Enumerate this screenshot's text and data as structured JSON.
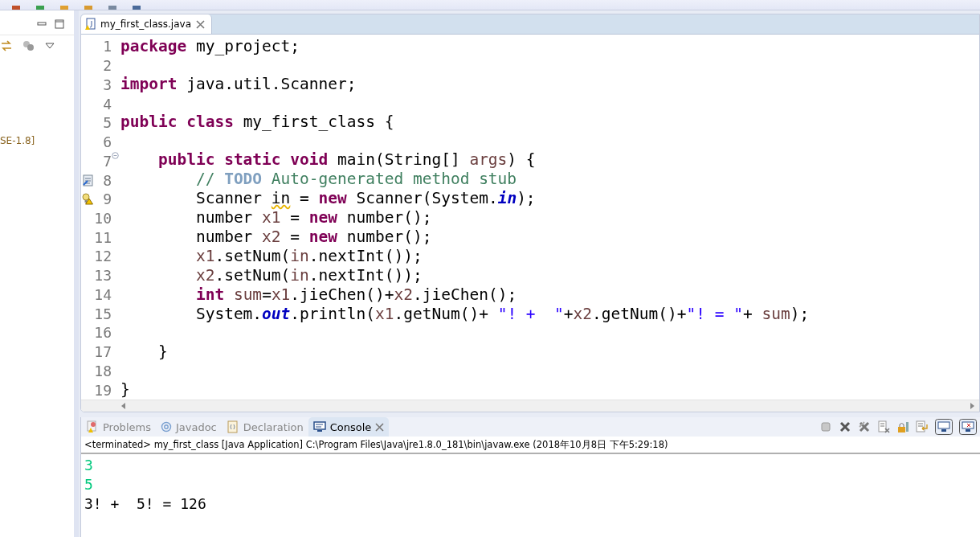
{
  "left_panel": {
    "label": "SE-1.8]"
  },
  "editor": {
    "tab": {
      "label": "my_first_class.java",
      "selected": true
    },
    "lines": [
      {
        "number": "1",
        "kind": "plain",
        "tokens": [
          {
            "kind": "kw",
            "text": "package"
          },
          {
            "kind": "plain",
            "text": " my_project;"
          }
        ]
      },
      {
        "number": "2",
        "kind": "plain"
      },
      {
        "number": "3",
        "kind": "plain",
        "tokens": [
          {
            "kind": "kw",
            "text": "import"
          },
          {
            "kind": "plain",
            "text": " java.util.Scanner;"
          }
        ]
      },
      {
        "number": "4",
        "kind": "plain"
      },
      {
        "number": "5",
        "kind": "plain",
        "tokens": [
          {
            "kind": "kw",
            "text": "public class"
          },
          {
            "kind": "plain",
            "text": " my_first_class {"
          }
        ]
      },
      {
        "number": "6",
        "kind": "plain"
      },
      {
        "number": "7",
        "kind": "fold",
        "tokens": [
          {
            "kind": "kw",
            "text": "    public static void"
          },
          {
            "kind": "plain",
            "text": " main(String[] "
          },
          {
            "kind": "var",
            "text": "args"
          },
          {
            "kind": "plain",
            "text": ") {"
          }
        ]
      },
      {
        "number": "8",
        "kind": "task",
        "tokens": [
          {
            "kind": "comment",
            "text": "        // "
          },
          {
            "kind": "todo",
            "text": "TODO"
          },
          {
            "kind": "comment",
            "text": " Auto-generated method stub"
          }
        ]
      },
      {
        "number": "9",
        "kind": "warning",
        "tokens": [
          {
            "kind": "plain",
            "text": "        Scanner "
          },
          {
            "kind": "warn",
            "text": "in"
          },
          {
            "kind": "plain",
            "text": " = "
          },
          {
            "kind": "kw",
            "text": "new"
          },
          {
            "kind": "plain",
            "text": " Scanner(System."
          },
          {
            "kind": "static",
            "text": "in"
          },
          {
            "kind": "plain",
            "text": ");"
          }
        ]
      },
      {
        "number": "10",
        "kind": "plain",
        "tokens": [
          {
            "kind": "plain",
            "text": "        number "
          },
          {
            "kind": "var",
            "text": "x1"
          },
          {
            "kind": "plain",
            "text": " = "
          },
          {
            "kind": "kw",
            "text": "new"
          },
          {
            "kind": "plain",
            "text": " number();"
          }
        ]
      },
      {
        "number": "11",
        "kind": "plain",
        "tokens": [
          {
            "kind": "plain",
            "text": "        number "
          },
          {
            "kind": "var",
            "text": "x2"
          },
          {
            "kind": "plain",
            "text": " = "
          },
          {
            "kind": "kw",
            "text": "new"
          },
          {
            "kind": "plain",
            "text": " number();"
          }
        ]
      },
      {
        "number": "12",
        "kind": "plain",
        "tokens": [
          {
            "kind": "var",
            "text": "        x1"
          },
          {
            "kind": "plain",
            "text": ".setNum("
          },
          {
            "kind": "var",
            "text": "in"
          },
          {
            "kind": "plain",
            "text": ".nextInt());"
          }
        ]
      },
      {
        "number": "13",
        "kind": "plain",
        "tokens": [
          {
            "kind": "var",
            "text": "        x2"
          },
          {
            "kind": "plain",
            "text": ".setNum("
          },
          {
            "kind": "var",
            "text": "in"
          },
          {
            "kind": "plain",
            "text": ".nextInt());"
          }
        ]
      },
      {
        "number": "14",
        "kind": "plain",
        "tokens": [
          {
            "kind": "kw",
            "text": "        int "
          },
          {
            "kind": "var",
            "text": "sum"
          },
          {
            "kind": "plain",
            "text": "="
          },
          {
            "kind": "var",
            "text": "x1"
          },
          {
            "kind": "plain",
            "text": ".jieChen()+"
          },
          {
            "kind": "var",
            "text": "x2"
          },
          {
            "kind": "plain",
            "text": ".jieChen();"
          }
        ]
      },
      {
        "number": "15",
        "kind": "plain",
        "tokens": [
          {
            "kind": "plain",
            "text": "        System."
          },
          {
            "kind": "static",
            "text": "out"
          },
          {
            "kind": "plain",
            "text": ".println("
          },
          {
            "kind": "var",
            "text": "x1"
          },
          {
            "kind": "plain",
            "text": ".getNum()+ "
          },
          {
            "kind": "str",
            "text": "\"! +  \""
          },
          {
            "kind": "plain",
            "text": "+"
          },
          {
            "kind": "var",
            "text": "x2"
          },
          {
            "kind": "plain",
            "text": ".getNum()+"
          },
          {
            "kind": "str",
            "text": "\"! = \""
          },
          {
            "kind": "plain",
            "text": "+ "
          },
          {
            "kind": "var",
            "text": "sum"
          },
          {
            "kind": "plain",
            "text": ");"
          }
        ]
      },
      {
        "number": "16",
        "kind": "plain"
      },
      {
        "number": "17",
        "kind": "plain",
        "tokens": [
          {
            "kind": "plain",
            "text": "    }"
          }
        ]
      },
      {
        "number": "18",
        "kind": "plain"
      },
      {
        "number": "19",
        "kind": "plain",
        "tokens": [
          {
            "kind": "plain",
            "text": "}"
          }
        ]
      }
    ]
  },
  "bottom_panel": {
    "tabs": [
      {
        "label": "Problems",
        "selected": false
      },
      {
        "label": "Javadoc",
        "selected": false
      },
      {
        "label": "Declaration",
        "selected": false
      },
      {
        "label": "Console",
        "selected": true
      }
    ],
    "header": "<terminated> my_first_class [Java Application] C:\\Program Files\\Java\\jre1.8.0_181\\bin\\javaw.exe (2018年10月8日 下午5:29:18)",
    "output": [
      {
        "kind": "input",
        "text": "3"
      },
      {
        "kind": "input",
        "text": "5"
      },
      {
        "kind": "output",
        "text": "3! +  5! = 126"
      }
    ]
  }
}
